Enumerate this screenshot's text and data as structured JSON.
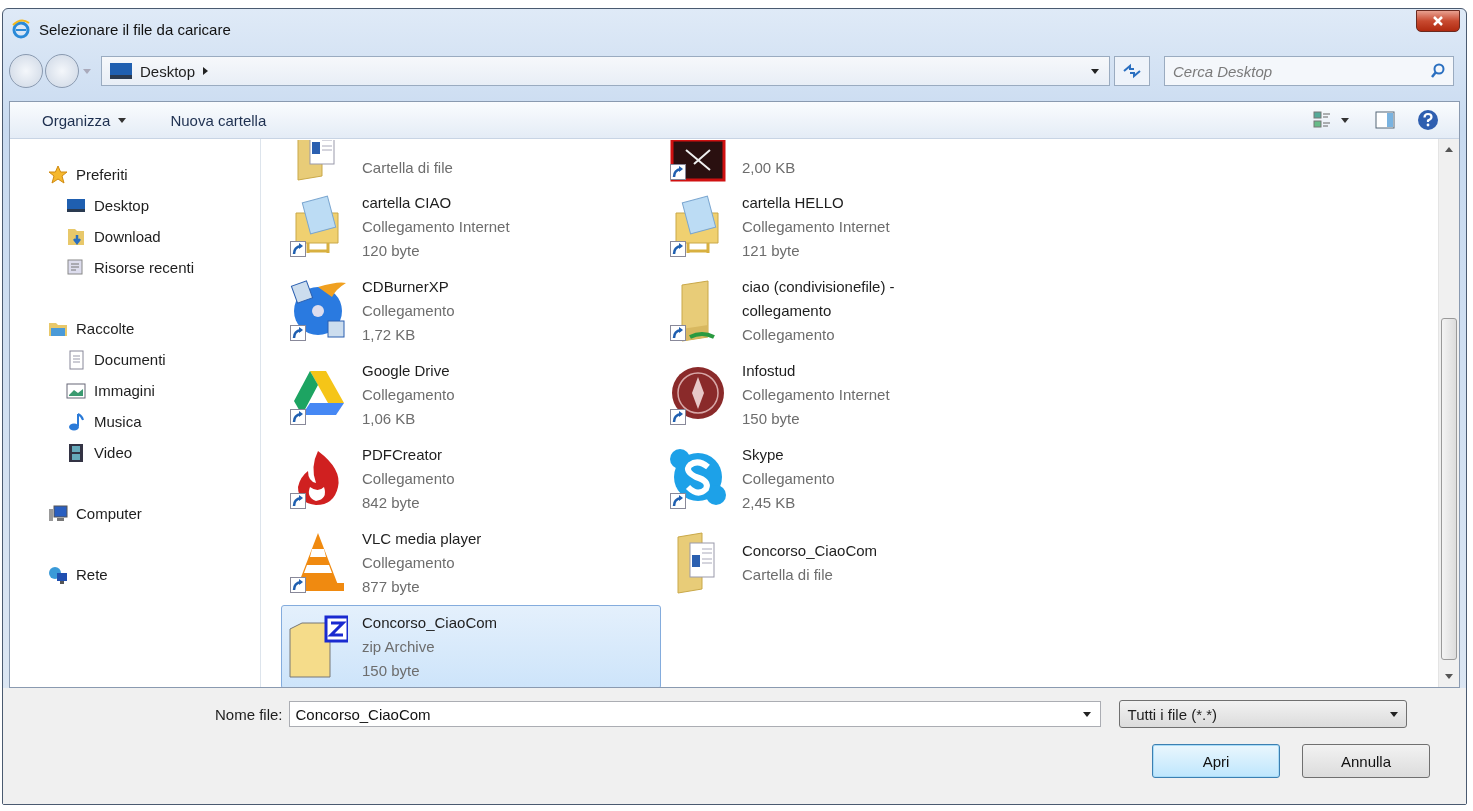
{
  "window": {
    "title": "Selezionare il file da caricare"
  },
  "address": {
    "crumbs": [
      {
        "label": "Desktop"
      }
    ],
    "search_placeholder": "Cerca Desktop"
  },
  "toolbar": [
    {
      "label": "Organizza",
      "dropdown": true
    },
    {
      "label": "Nuova cartella",
      "dropdown": false
    }
  ],
  "sidebar": {
    "items": [
      {
        "label": "Preferiti",
        "kind": "star",
        "children": [
          {
            "label": "Desktop",
            "kind": "desktop"
          },
          {
            "label": "Download",
            "kind": "download"
          },
          {
            "label": "Risorse recenti",
            "kind": "recent"
          }
        ]
      },
      {
        "label": "Raccolte",
        "kind": "library",
        "children": [
          {
            "label": "Documenti",
            "kind": "document"
          },
          {
            "label": "Immagini",
            "kind": "picture"
          },
          {
            "label": "Musica",
            "kind": "music"
          },
          {
            "label": "Video",
            "kind": "video"
          }
        ]
      },
      {
        "label": "Computer",
        "kind": "computer"
      },
      {
        "label": "Rete",
        "kind": "network"
      }
    ]
  },
  "files": [
    {
      "kind": "folder-doc",
      "shortcut": false,
      "selected": false,
      "details": [
        "Cartella di file"
      ]
    },
    {
      "kind": "red-app",
      "shortcut": true,
      "selected": false,
      "details": [
        "2,00 KB"
      ]
    },
    {
      "name": "cartella CIAO",
      "kind": "internet-folder",
      "shortcut": true,
      "selected": false,
      "details": [
        "Collegamento Internet",
        "120 byte"
      ]
    },
    {
      "name": "cartella HELLO",
      "kind": "internet-folder",
      "shortcut": true,
      "selected": false,
      "details": [
        "Collegamento Internet",
        "121 byte"
      ]
    },
    {
      "name": "CDBurnerXP",
      "kind": "disc",
      "shortcut": true,
      "selected": false,
      "details": [
        "Collegamento",
        "1,72 KB"
      ]
    },
    {
      "name": "ciao (condivisionefile) - collegamento",
      "kind": "folder",
      "shortcut": true,
      "selected": false,
      "details": [
        "Collegamento"
      ]
    },
    {
      "name": "Google Drive",
      "kind": "drive",
      "shortcut": true,
      "selected": false,
      "details": [
        "Collegamento",
        "1,06 KB"
      ]
    },
    {
      "name": "Infostud",
      "kind": "seal",
      "shortcut": true,
      "selected": false,
      "details": [
        "Collegamento Internet",
        "150 byte"
      ]
    },
    {
      "name": "PDFCreator",
      "kind": "flame",
      "shortcut": true,
      "selected": false,
      "details": [
        "Collegamento",
        "842 byte"
      ]
    },
    {
      "name": "Skype",
      "kind": "skype",
      "shortcut": true,
      "selected": false,
      "details": [
        "Collegamento",
        "2,45 KB"
      ]
    },
    {
      "name": "VLC media player",
      "kind": "cone",
      "shortcut": true,
      "selected": false,
      "details": [
        "Collegamento",
        "877 byte"
      ]
    },
    {
      "name": "Concorso_CiaoCom",
      "kind": "folder-doc",
      "shortcut": false,
      "selected": false,
      "details": [
        "Cartella di file"
      ]
    },
    {
      "name": "Concorso_CiaoCom",
      "kind": "zip",
      "shortcut": false,
      "selected": true,
      "details": [
        "zip Archive",
        "150 byte"
      ]
    }
  ],
  "footer": {
    "filename_label": "Nome file:",
    "filename": "Concorso_CiaoCom",
    "filter": "Tutti i file (*.*)",
    "buttons": [
      {
        "label": "Apri",
        "default": true
      },
      {
        "label": "Annulla",
        "default": false
      }
    ]
  }
}
